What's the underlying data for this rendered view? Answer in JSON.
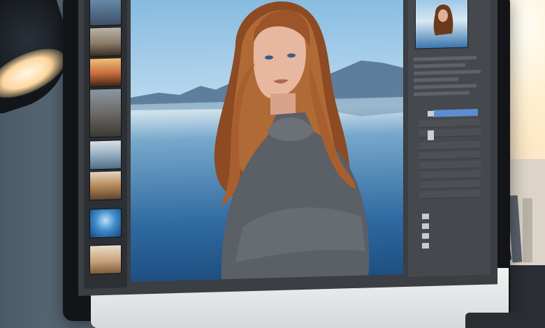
{
  "scene": {
    "description_kind": "photo-editing-workstation",
    "colors": {
      "sky": "#85bbe0",
      "water": "#1e4f82",
      "hair": "#a35a2e",
      "sweater": "#5b5f66",
      "skin": "#e8b79f",
      "ui_panel": "#45484d",
      "selected_layer": "#5b8ed0"
    }
  },
  "filmstrip": {
    "thumbnails": [
      {
        "icon": "portrait-thumbnail"
      },
      {
        "icon": "trees-thumbnail"
      },
      {
        "icon": "sunset-thumbnail"
      },
      {
        "icon": "pier-thumbnail"
      },
      {
        "icon": "lake-thumbnail"
      },
      {
        "icon": "field-thumbnail"
      },
      {
        "icon": "blue-water-thumbnail"
      },
      {
        "icon": "rock-thumbnail"
      }
    ]
  },
  "panels": {
    "navigator_icon": "navigator-preview",
    "layers_icon": "layers-panel"
  }
}
